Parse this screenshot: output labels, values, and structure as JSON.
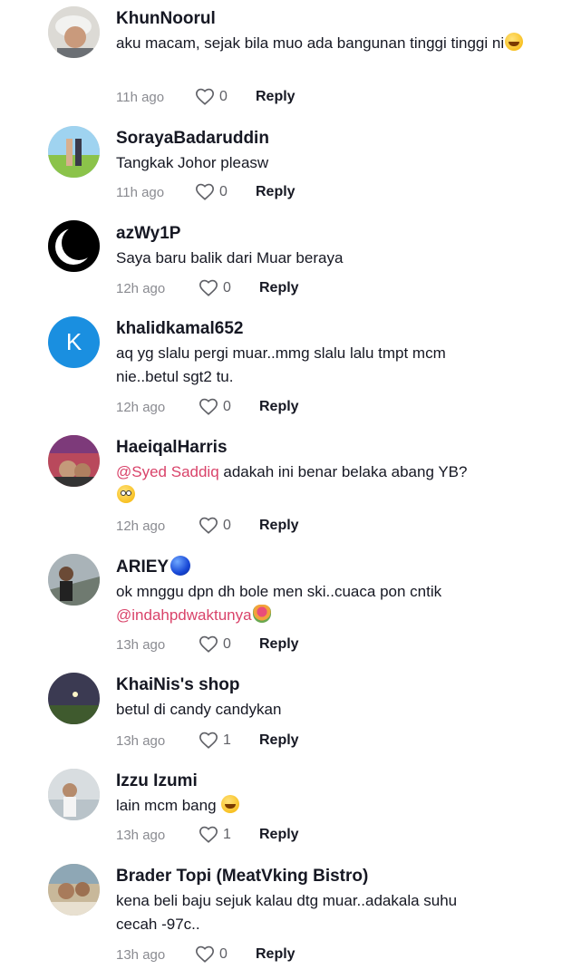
{
  "comments": [
    {
      "username": "KhunNoorul",
      "text": "aku macam, sejak bila muo ada bangunan tinggi tinggi ni",
      "emoji": "grinning-sweat-emoji",
      "time": "11h ago",
      "likes": "0",
      "reply": "Reply"
    },
    {
      "username": "SorayaBadaruddin",
      "text": "Tangkak Johor pleasw",
      "time": "11h ago",
      "likes": "0",
      "reply": "Reply"
    },
    {
      "username": "azWy1P",
      "text": "Saya baru balik dari Muar beraya",
      "time": "12h ago",
      "likes": "0",
      "reply": "Reply"
    },
    {
      "username": "khalidkamal652",
      "avatar_letter": "K",
      "text": "aq yg slalu pergi muar..mmg slalu lalu tmpt mcm nie..betul sgt2 tu.",
      "time": "12h ago",
      "likes": "0",
      "reply": "Reply"
    },
    {
      "username": "HaeiqalHarris",
      "mention": "@Syed Saddiq",
      "text": " adakah ini benar belaka abang YB?",
      "emoji": "flushed-emoji",
      "time": "12h ago",
      "likes": "0",
      "reply": "Reply"
    },
    {
      "username": "ARIEY",
      "badge": "blue-circle-emoji",
      "text": "ok mnggu dpn dh bole men ski..cuaca pon cntik ",
      "mention": "@indahpdwaktunya",
      "emoji": "bouquet-emoji",
      "time": "13h ago",
      "likes": "0",
      "reply": "Reply"
    },
    {
      "username": "KhaiNis's shop",
      "text": "betul di candy candykan",
      "time": "13h ago",
      "likes": "1",
      "reply": "Reply"
    },
    {
      "username": "Izzu Izumi",
      "text": "lain mcm bang ",
      "emoji": "grinning-sweat-emoji",
      "time": "13h ago",
      "likes": "1",
      "reply": "Reply"
    },
    {
      "username": "Brader Topi (MeatVking Bistro)",
      "text": "kena beli baju sejuk kalau dtg muar..adakala suhu cecah -97c..",
      "time": "13h ago",
      "likes": "0",
      "reply": "Reply"
    }
  ],
  "colors": {
    "mention": "#d9436a",
    "meta": "#8a8b91",
    "avatar_k": "#1a8fe0"
  }
}
